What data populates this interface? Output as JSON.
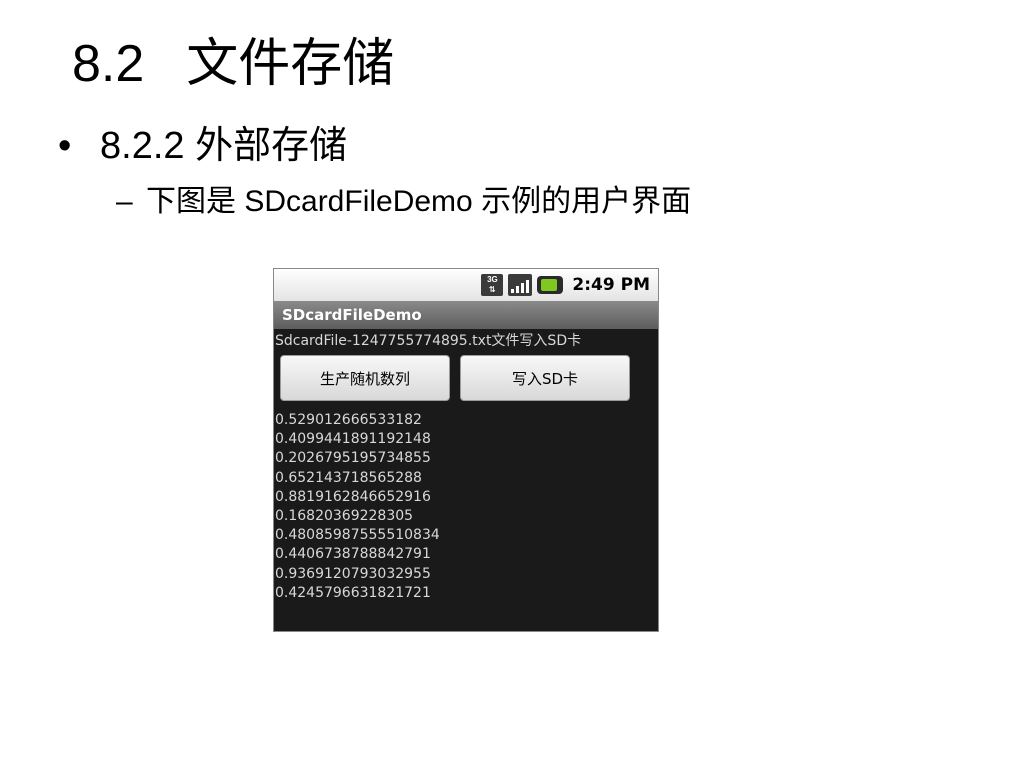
{
  "slide": {
    "title_number": "8.2",
    "title_text": "文件存储",
    "bullet_dot": "•",
    "bullet_text": "8.2.2  外部存储",
    "sub_dash": "–",
    "sub_text": "下图是 SDcardFileDemo 示例的用户界面"
  },
  "phone": {
    "statusbar": {
      "network_label": "3G",
      "time": "2:49 PM"
    },
    "app_title": "SDcardFileDemo",
    "file_message": "SdcardFile-1247755774895.txt文件写入SD卡",
    "buttons": {
      "generate_label": "生产随机数列",
      "write_label": "写入SD卡"
    },
    "numbers": [
      "0.529012666533182",
      "0.4099441891192148",
      "0.2026795195734855",
      "0.652143718565288",
      "0.8819162846652916",
      "0.16820369228305",
      "0.48085987555510834",
      "0.4406738788842791",
      "0.9369120793032955",
      "0.4245796631821721"
    ]
  }
}
